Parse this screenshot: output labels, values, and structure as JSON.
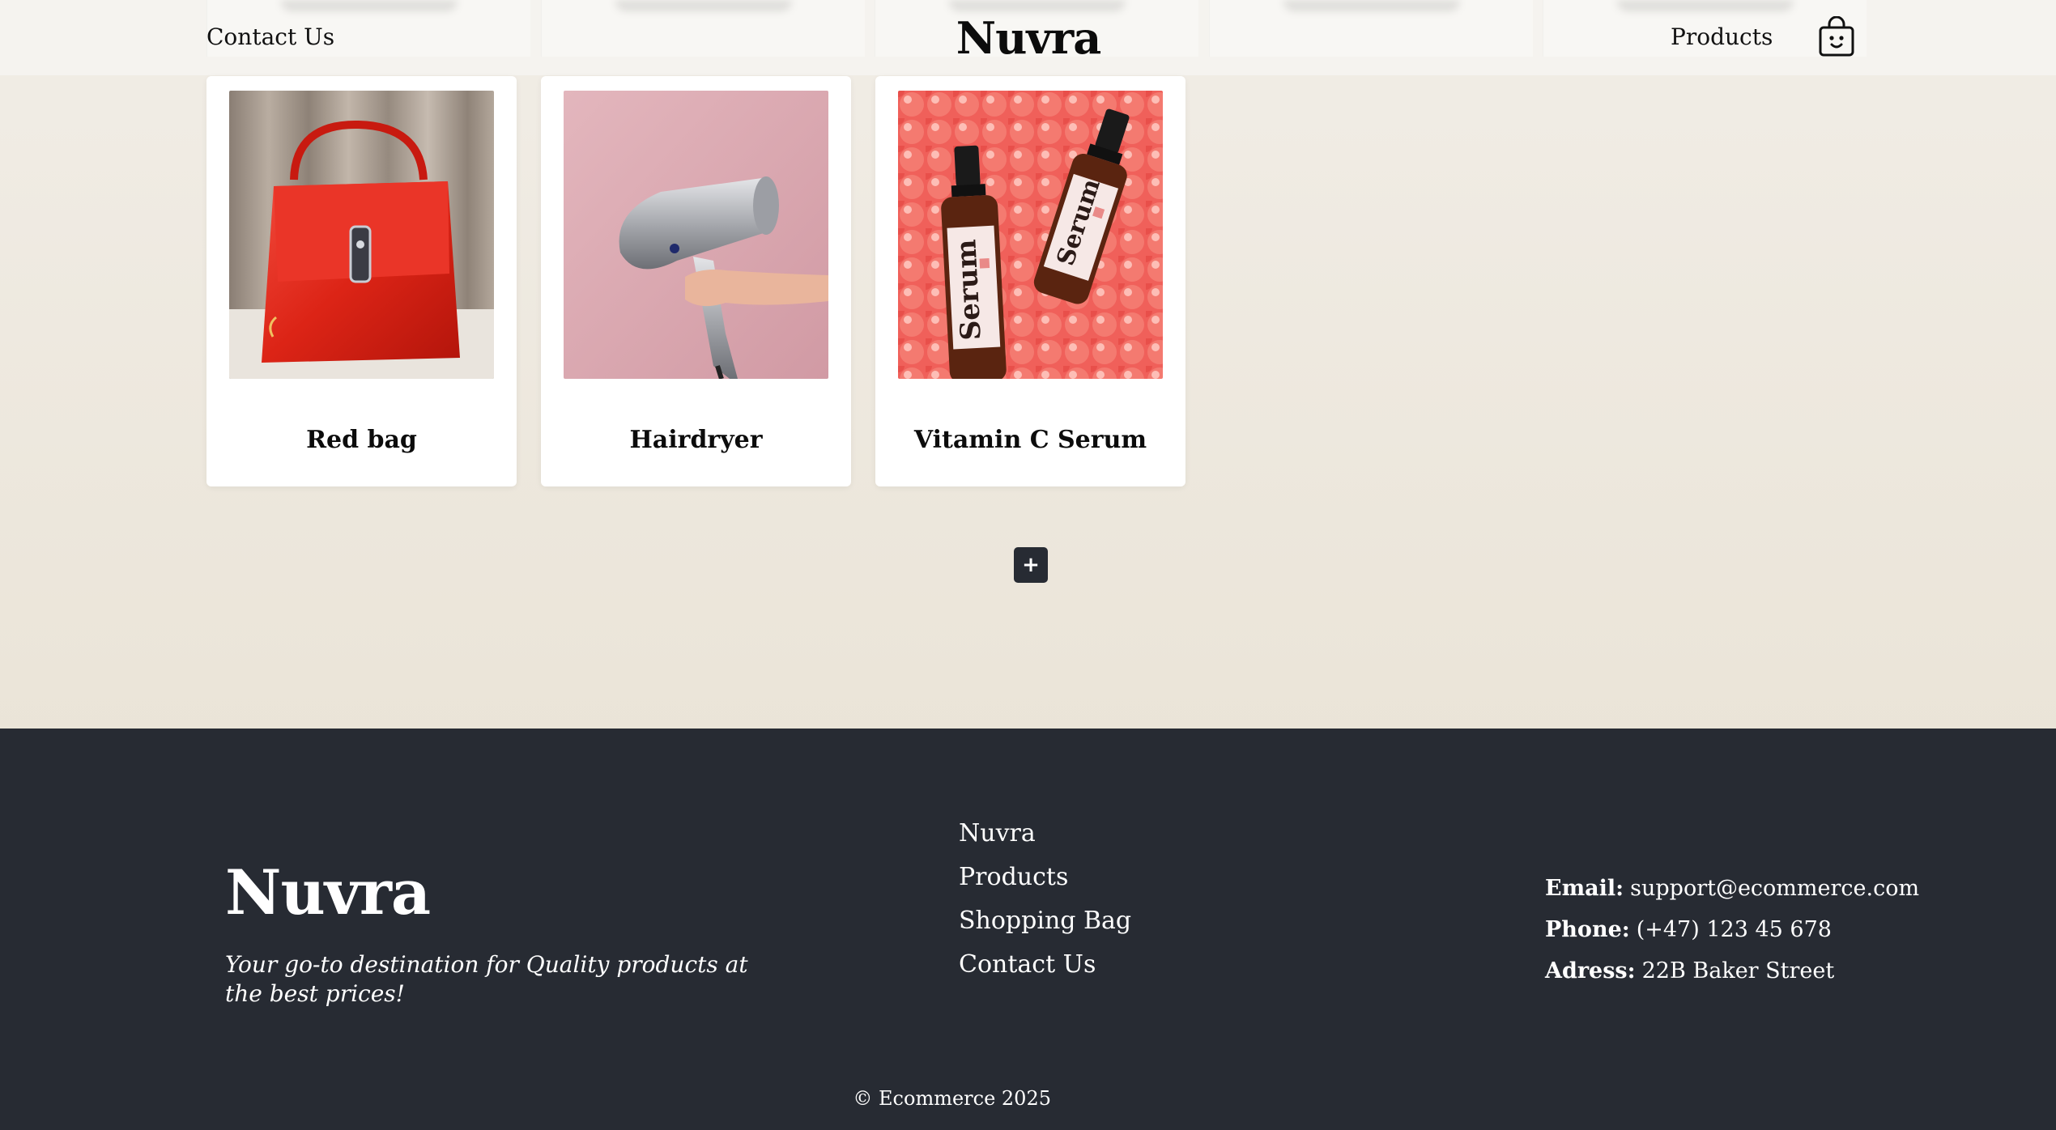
{
  "header": {
    "contact_label": "Contact Us",
    "brand": "Nuvra",
    "products_label": "Products",
    "bag_icon": "shopping-bag-icon"
  },
  "products": [
    {
      "title": "Red bag"
    },
    {
      "title": "Hairdryer"
    },
    {
      "title": "Vitamin C Serum",
      "image_label": "Serum"
    }
  ],
  "add_button_label": "+",
  "footer": {
    "brand": "Nuvra",
    "tagline": "Your go-to destination for Quality products at the best prices!",
    "links": [
      "Nuvra",
      "Products",
      "Shopping Bag",
      "Contact Us"
    ],
    "contact": {
      "email_label": "Email:",
      "email": "support@ecommerce.com",
      "phone_label": "Phone:",
      "phone": "(+47) 123 45 678",
      "address_label": "Adress:",
      "address": "22B Baker Street"
    },
    "copyright": "© Ecommerce 2025"
  },
  "colors": {
    "footer_bg": "#272b33",
    "page_bg": "#ede8df",
    "add_button_bg": "#272b33"
  }
}
